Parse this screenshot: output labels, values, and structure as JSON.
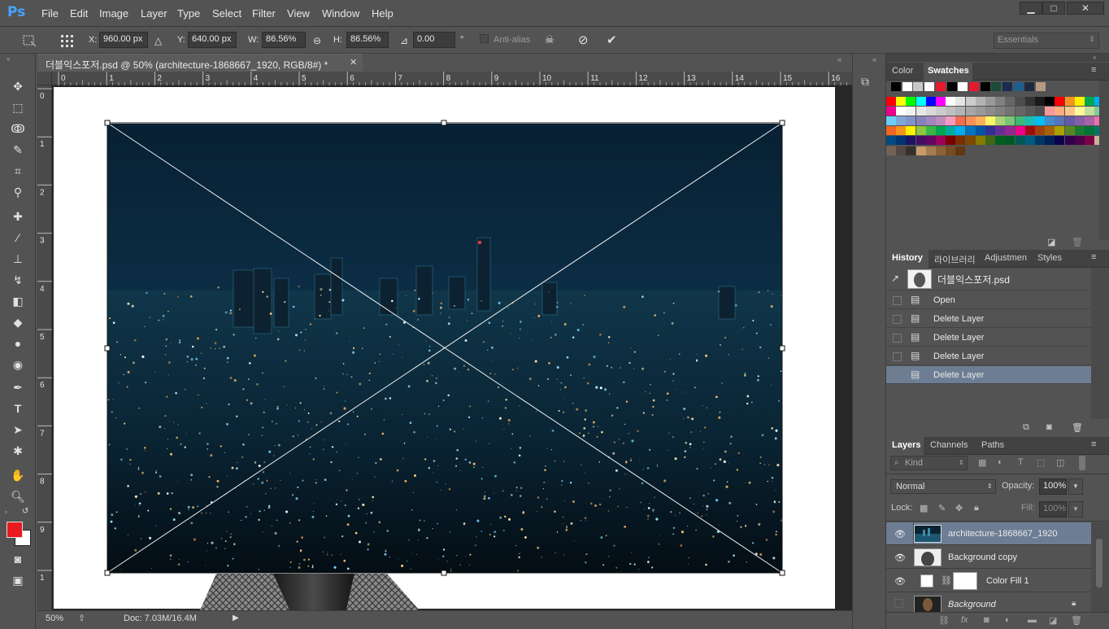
{
  "app": {
    "logo": "Ps"
  },
  "menu": [
    "File",
    "Edit",
    "Image",
    "Layer",
    "Type",
    "Select",
    "Filter",
    "View",
    "Window",
    "Help"
  ],
  "window_controls": {
    "minimize": "▁",
    "maximize": "□",
    "close": "✕"
  },
  "options": {
    "x_label": "X:",
    "x_value": "960.00 px",
    "y_label": "Y:",
    "y_value": "640.00 px",
    "w_label": "W:",
    "w_value": "86.56%",
    "h_label": "H:",
    "h_value": "86.56%",
    "angle_value": "0.00",
    "angle_unit": "°",
    "antialias_label": "Anti-alias",
    "workspace": "Essentials"
  },
  "document": {
    "tab_title": "더블익스포저.psd @ 50% (architecture-1868667_1920, RGB/8#) *",
    "ruler_h": [
      "0",
      "1",
      "2",
      "3",
      "4",
      "5",
      "6",
      "7",
      "8",
      "9",
      "10",
      "11",
      "12",
      "13",
      "14",
      "15",
      "16"
    ],
    "ruler_v": [
      "0",
      "1",
      "2",
      "3",
      "4",
      "5",
      "6",
      "7",
      "8",
      "9",
      "1"
    ],
    "zoom": "50%",
    "doc_info": "Doc: 7.03M/16.4M"
  },
  "swatches_panel": {
    "tabs": [
      "Color",
      "Swatches"
    ],
    "active_tab": "Swatches",
    "top_row": [
      "#000000",
      "#ffffff",
      "#c8c8c8",
      "#ffffff",
      "#e8192c",
      "#000000",
      "#ffffff",
      "#e8192c",
      "#000000",
      "#1b4a38",
      "#1a2c4f",
      "#1d5e8c",
      "#1e2a3d",
      "#b79a82"
    ],
    "grid_colors": [
      "#ff0000",
      "#ffff00",
      "#00ff00",
      "#00ffff",
      "#0000ff",
      "#ff00ff",
      "#ffffff",
      "#e6e6e6",
      "#cccccc",
      "#b3b3b3",
      "#999999",
      "#808080",
      "#666666",
      "#4d4d4d",
      "#333333",
      "#1a1a1a",
      "#000000",
      "#ff0000",
      "#f7941d",
      "#fff200",
      "#00a651",
      "#00aeef",
      "#2e3192",
      "#ec008c",
      "#ffffff",
      "#f2f2f2",
      "#e6e6e6",
      "#d9d9d9",
      "#cccccc",
      "#bfbfbf",
      "#b3b3b3",
      "#a6a6a6",
      "#999999",
      "#8c8c8c",
      "#808080",
      "#737373",
      "#666666",
      "#595959",
      "#4d4d4d",
      "#f5989d",
      "#f9ad81",
      "#fdc689",
      "#fff799",
      "#c4df9b",
      "#82ca9c",
      "#7accc8",
      "#6dcff6",
      "#7da7d9",
      "#8393ca",
      "#8781bd",
      "#a186be",
      "#bd8cbf",
      "#f49ac1",
      "#f26c4f",
      "#f68e55",
      "#fbaf5c",
      "#fff467",
      "#acd373",
      "#7cc576",
      "#3cb878",
      "#1cbbb4",
      "#00bff3",
      "#448ccb",
      "#5574b9",
      "#605ca8",
      "#855fa8",
      "#a763a8",
      "#f06ea9",
      "#ed1c24",
      "#f26522",
      "#f7941d",
      "#fff200",
      "#8dc63f",
      "#39b54a",
      "#00a651",
      "#00a99d",
      "#00aeef",
      "#0072bc",
      "#0054a6",
      "#2e3192",
      "#662d91",
      "#92278f",
      "#ec008c",
      "#9e0b0f",
      "#a0410d",
      "#a3620a",
      "#aba000",
      "#598527",
      "#197b30",
      "#007236",
      "#00746b",
      "#0076a3",
      "#004a80",
      "#003471",
      "#1b1464",
      "#440e62",
      "#630460",
      "#9e005d",
      "#790000",
      "#7b2e00",
      "#7d4900",
      "#827b00",
      "#406618",
      "#005e20",
      "#005826",
      "#005952",
      "#005b7f",
      "#003663",
      "#002157",
      "#0d004c",
      "#32004b",
      "#4b0049",
      "#7b0046",
      "#c7b299",
      "#998675",
      "#736357",
      "#534741",
      "#37302d",
      "#c69c6d",
      "#a67c52",
      "#8c6239",
      "#754c24",
      "#603913"
    ]
  },
  "history_panel": {
    "tabs": [
      "History",
      "라이브러리",
      "Adjustmen",
      "Styles"
    ],
    "active_tab": "History",
    "snapshot": "더블익스포저.psd",
    "items": [
      "Open",
      "Delete Layer",
      "Delete Layer",
      "Delete Layer",
      "Delete Layer"
    ],
    "selected_index": 4
  },
  "layers_panel": {
    "tabs": [
      "Layers",
      "Channels",
      "Paths"
    ],
    "active_tab": "Layers",
    "filter_placeholder": "Kind",
    "blend_mode": "Normal",
    "opacity_label": "Opacity:",
    "opacity_value": "100%",
    "lock_label": "Lock:",
    "fill_label": "Fill:",
    "fill_value": "100%",
    "layers": [
      {
        "name": "architecture-1868667_1920",
        "selected": true
      },
      {
        "name": "Background copy",
        "selected": false
      },
      {
        "name": "Color Fill 1",
        "selected": false
      },
      {
        "name": "Background",
        "selected": false
      }
    ]
  },
  "colors": {
    "foreground": "#e8191f",
    "background": "#ffffff",
    "accent_selected": "#6d7d93",
    "ps_blue": "#45a3ff"
  }
}
